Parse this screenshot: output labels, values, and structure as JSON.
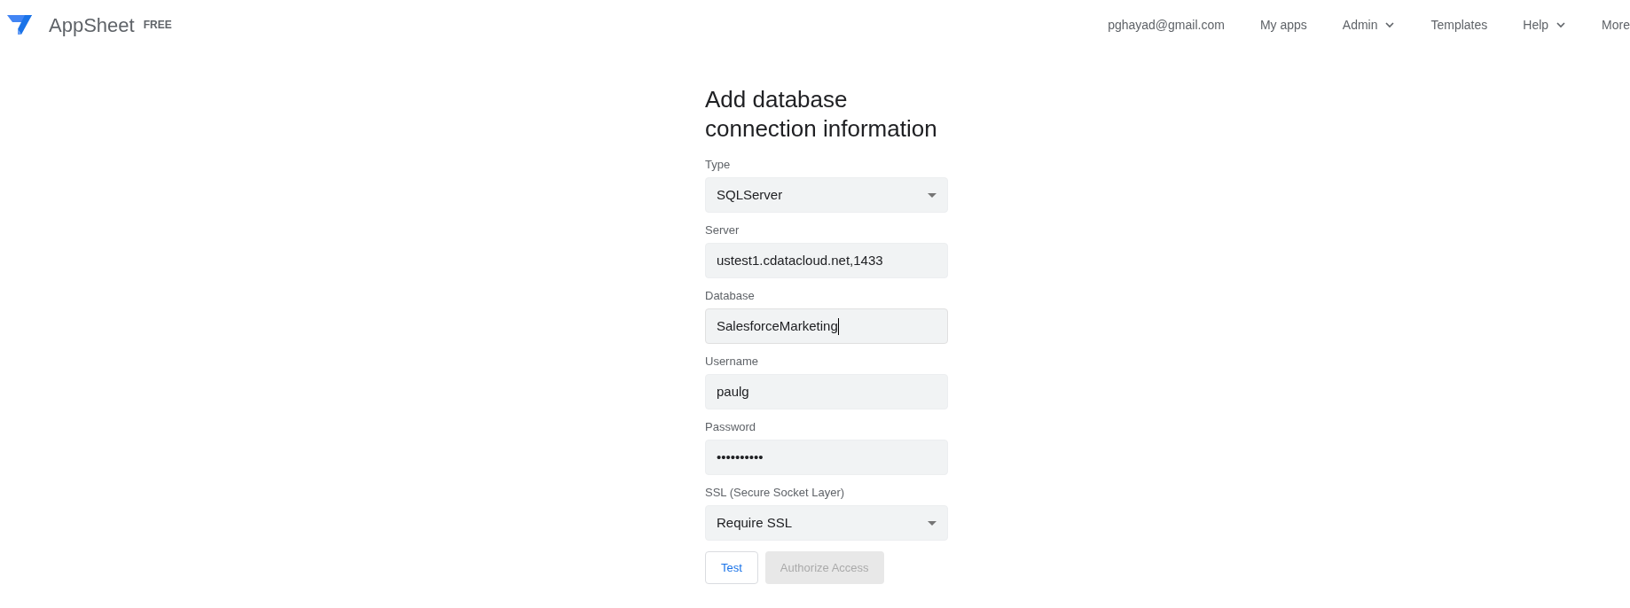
{
  "header": {
    "brand": "AppSheet",
    "plan": "FREE",
    "nav": [
      {
        "label": "pghayad@gmail.com",
        "has_menu": false
      },
      {
        "label": "My apps",
        "has_menu": false
      },
      {
        "label": "Admin",
        "has_menu": true
      },
      {
        "label": "Templates",
        "has_menu": false
      },
      {
        "label": "Help",
        "has_menu": true
      },
      {
        "label": "More",
        "has_menu": false
      }
    ]
  },
  "form": {
    "title": "Add database connection information",
    "fields": [
      {
        "kind": "select",
        "label": "Type",
        "value": "SQLServer",
        "focused": false
      },
      {
        "kind": "text",
        "label": "Server",
        "value": "ustest1.cdatacloud.net,1433",
        "focused": false
      },
      {
        "kind": "text",
        "label": "Database",
        "value": "SalesforceMarketing",
        "focused": true
      },
      {
        "kind": "text",
        "label": "Username",
        "value": "paulg",
        "focused": false
      },
      {
        "kind": "password",
        "label": "Password",
        "value": "••••••••••",
        "focused": false
      },
      {
        "kind": "select",
        "label": "SSL (Secure Socket Layer)",
        "value": "Require SSL",
        "focused": false
      }
    ],
    "buttons": [
      {
        "label": "Test",
        "disabled": false
      },
      {
        "label": "Authorize Access",
        "disabled": true
      }
    ]
  }
}
